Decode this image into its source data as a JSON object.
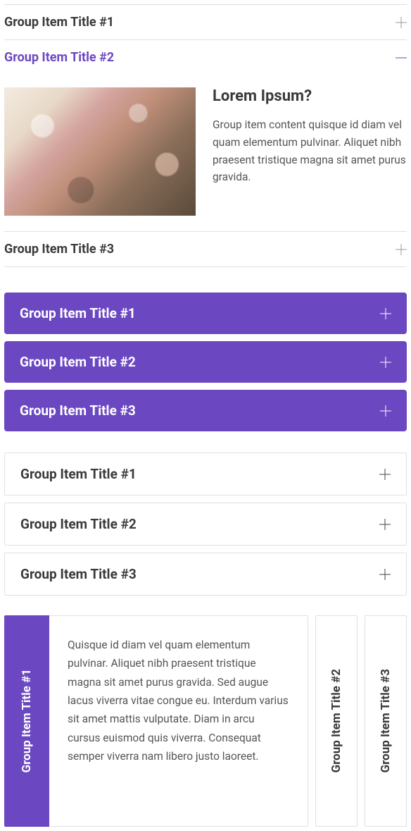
{
  "acc1": {
    "items": [
      {
        "title": "Group Item Title #1"
      },
      {
        "title": "Group Item Title #2"
      },
      {
        "title": "Group Item Title #3"
      }
    ],
    "active": {
      "heading": "Lorem Ipsum?",
      "body": "Group item content quisque id diam vel quam elementum pulvinar. Aliquet nibh praesent tristique magna sit amet purus gravida."
    }
  },
  "acc2": {
    "items": [
      {
        "title": "Group Item Title #1"
      },
      {
        "title": "Group Item Title #2"
      },
      {
        "title": "Group Item Title #3"
      }
    ]
  },
  "acc3": {
    "items": [
      {
        "title": "Group Item Title #1"
      },
      {
        "title": "Group Item Title #2"
      },
      {
        "title": "Group Item Title #3"
      }
    ]
  },
  "vtabs": {
    "items": [
      {
        "title": "Group Item Title #1"
      },
      {
        "title": "Group Item Title #2"
      },
      {
        "title": "Group Item Title #3"
      }
    ],
    "panel": "Quisque id diam vel quam elementum pulvinar. Aliquet nibh praesent tristique magna sit amet purus gravida. Sed augue lacus viverra vitae congue eu. Interdum varius sit amet mattis vulputate. Diam in arcu cursus euismod quis viverra. Consequat semper viverra nam libero justo laoreet."
  }
}
